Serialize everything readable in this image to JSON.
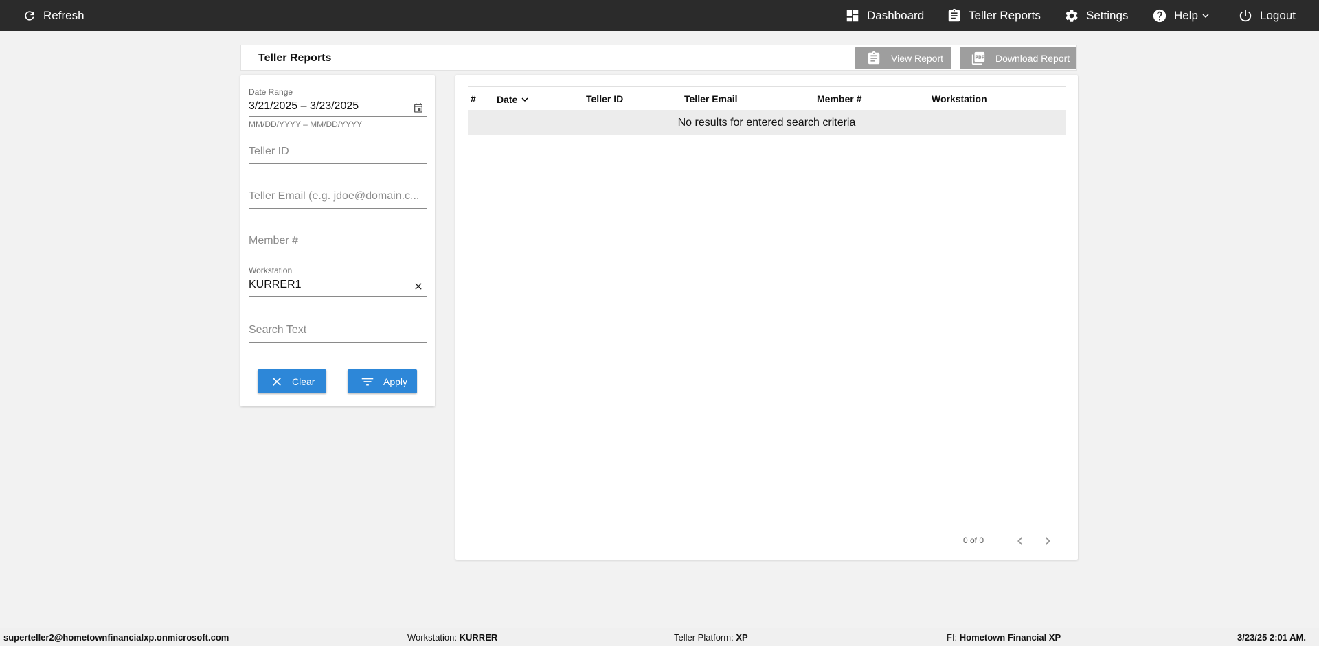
{
  "topbar": {
    "refresh_label": "Refresh",
    "nav": {
      "dashboard": "Dashboard",
      "teller_reports": "Teller Reports",
      "settings": "Settings",
      "help": "Help",
      "logout": "Logout"
    }
  },
  "header": {
    "title": "Teller Reports",
    "view_report_label": "View Report",
    "download_report_label": "Download Report"
  },
  "filters": {
    "date_range": {
      "label": "Date Range",
      "value": "3/21/2025 – 3/23/2025",
      "hint": "MM/DD/YYYY – MM/DD/YYYY"
    },
    "teller_id": {
      "placeholder": "Teller ID"
    },
    "teller_email": {
      "placeholder": "Teller Email (e.g. jdoe@domain.c..."
    },
    "member": {
      "placeholder": "Member #"
    },
    "workstation": {
      "label": "Workstation",
      "value": "KURRER1"
    },
    "search_text": {
      "placeholder": "Search Text"
    },
    "clear_label": "Clear",
    "apply_label": "Apply"
  },
  "table": {
    "columns": [
      "#",
      "Date",
      "Teller ID",
      "Teller Email",
      "Member #",
      "Workstation"
    ],
    "empty_message": "No results for entered search criteria",
    "pager_text": "0 of 0"
  },
  "statusbar": {
    "user": "superteller2@hometownfinancialxp.onmicrosoft.com",
    "workstation_label": "Workstation:",
    "workstation_value": "KURRER",
    "platform_label": "Teller Platform:",
    "platform_value": "XP",
    "fi_label": "FI:",
    "fi_value": "Hometown Financial XP",
    "datetime": "3/23/25 2:01 AM."
  },
  "colors": {
    "topbar": "#2b2b2b",
    "primary_button": "#2d87d8",
    "disabled_button": "#9e9e9e",
    "background": "#f2f2f2"
  }
}
